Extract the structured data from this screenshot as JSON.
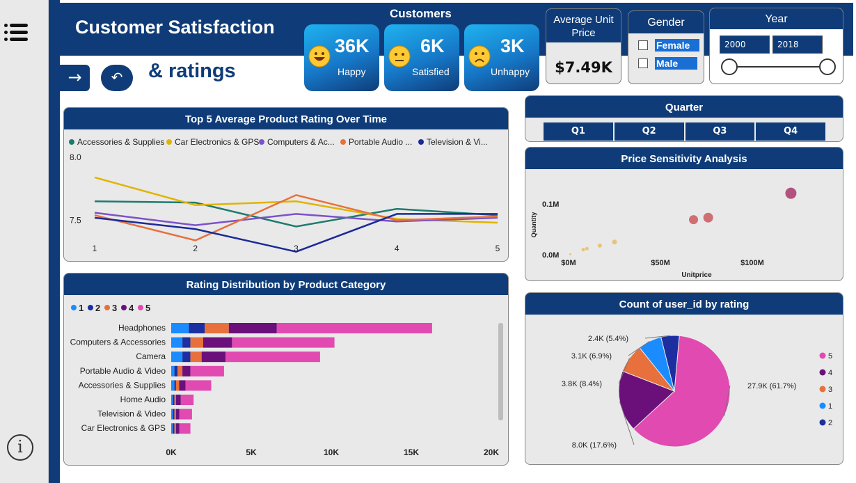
{
  "header": {
    "title_line1": "Customer Satisfaction",
    "title_line2": "& ratings"
  },
  "nav": {
    "forward_icon": "→",
    "back_icon": "↶"
  },
  "info_icon": "i",
  "customers": {
    "title": "Customers",
    "cards": [
      {
        "value": "36K",
        "label": "Happy",
        "emoji": "grinning-face-icon"
      },
      {
        "value": "6K",
        "label": "Satisfied",
        "emoji": "neutral-face-icon"
      },
      {
        "value": "3K",
        "label": "Unhappy",
        "emoji": "frowning-face-icon"
      }
    ]
  },
  "avg_unit_price": {
    "title": "Average Unit Price",
    "value": "$7.49K"
  },
  "gender": {
    "title": "Gender",
    "options": [
      "Female",
      "Male"
    ]
  },
  "year": {
    "title": "Year",
    "from": "2000",
    "to": "2018"
  },
  "quarter": {
    "title": "Quarter",
    "options": [
      "Q1",
      "Q2",
      "Q3",
      "Q4"
    ]
  },
  "colors": {
    "navy": "#0f3c78",
    "teal": "#1f7a6e",
    "gold": "#e0b400",
    "purple": "#7b52c9",
    "orange": "#e8703c",
    "darkblue": "#1b2a96",
    "r1": "#1a8cff",
    "r2": "#1c2ea0",
    "r3": "#e8703c",
    "r4": "#6b0f7a",
    "r5": "#e14ab0"
  },
  "chart_data": [
    {
      "id": "line",
      "type": "line",
      "title": "Top 5 Average Product Rating Over Time",
      "x": [
        "1",
        "2",
        "3",
        "4",
        "5"
      ],
      "ytick_labels": [
        "8.0",
        "7.5"
      ],
      "ylim": [
        7.32,
        8.0
      ],
      "series": [
        {
          "name": "Accessories & Supplies",
          "color": "#1f7a6e",
          "values": [
            7.65,
            7.64,
            7.45,
            7.59,
            7.54
          ]
        },
        {
          "name": "Car Electronics & GPS",
          "color": "#e0b400",
          "values": [
            7.84,
            7.62,
            7.65,
            7.51,
            7.48
          ]
        },
        {
          "name": "Computers & Ac...",
          "color": "#7b52c9",
          "values": [
            7.56,
            7.46,
            7.55,
            7.49,
            7.52
          ]
        },
        {
          "name": "Portable Audio ...",
          "color": "#e8703c",
          "values": [
            7.54,
            7.34,
            7.7,
            7.5,
            7.53
          ]
        },
        {
          "name": "Television & Vi...",
          "color": "#1b2a96",
          "values": [
            7.52,
            7.43,
            7.25,
            7.55,
            7.55
          ]
        }
      ]
    },
    {
      "id": "bar",
      "type": "bar",
      "title": "Rating Distribution by Product Category",
      "legend": [
        "1",
        "2",
        "3",
        "4",
        "5"
      ],
      "colors": [
        "#1a8cff",
        "#1c2ea0",
        "#e8703c",
        "#6b0f7a",
        "#e14ab0"
      ],
      "categories": [
        "Headphones",
        "Computers & Accessories",
        "Camera",
        "Portable Audio & Video",
        "Accessories & Supplies",
        "Home Audio",
        "Television & Video",
        "Car Electronics & GPS"
      ],
      "stacks": [
        [
          1100,
          1000,
          1500,
          3000,
          9700
        ],
        [
          700,
          500,
          800,
          1800,
          6400
        ],
        [
          700,
          500,
          700,
          1500,
          5900
        ],
        [
          200,
          200,
          300,
          500,
          2100
        ],
        [
          200,
          100,
          200,
          400,
          1600
        ],
        [
          100,
          100,
          100,
          300,
          800
        ],
        [
          100,
          100,
          100,
          200,
          800
        ],
        [
          100,
          100,
          100,
          200,
          700
        ]
      ],
      "xticks": [
        "0K",
        "5K",
        "10K",
        "15K",
        "20K"
      ],
      "xlim": [
        0,
        20000
      ]
    },
    {
      "id": "scatter",
      "type": "scatter",
      "title": "Price Sensitivity Analysis",
      "xlabel": "Unitprice",
      "ylabel": "Quantity",
      "xticks": [
        "$0M",
        "$50M",
        "$100M"
      ],
      "yticks": [
        "0.0M",
        "0.1M"
      ],
      "xlim": [
        0,
        100
      ],
      "ylim": [
        0,
        0.1
      ],
      "points": [
        {
          "x": 1,
          "y": 0.001,
          "size": 1.5,
          "color": "#e8c47a"
        },
        {
          "x": 8,
          "y": 0.01,
          "size": 2.5,
          "color": "#e8c47a"
        },
        {
          "x": 10,
          "y": 0.012,
          "size": 2.5,
          "color": "#e8c47a"
        },
        {
          "x": 17,
          "y": 0.018,
          "size": 3,
          "color": "#e8c47a"
        },
        {
          "x": 25,
          "y": 0.025,
          "size": 3.5,
          "color": "#e8c47a"
        },
        {
          "x": 68,
          "y": 0.069,
          "size": 6.5,
          "color": "#cf6e73"
        },
        {
          "x": 76,
          "y": 0.073,
          "size": 7,
          "color": "#cf6e73"
        },
        {
          "x": 121,
          "y": 0.121,
          "size": 8,
          "color": "#b3527e"
        }
      ]
    },
    {
      "id": "pie",
      "type": "pie",
      "title": "Count of user_id by rating",
      "slices": [
        {
          "label": "5",
          "value": 27.9,
          "text": "27.9K (61.7%)",
          "color": "#e14ab0"
        },
        {
          "label": "4",
          "value": 8.0,
          "text": "8.0K (17.6%)",
          "color": "#6b0f7a"
        },
        {
          "label": "3",
          "value": 3.8,
          "text": "3.8K (8.4%)",
          "color": "#e8703c"
        },
        {
          "label": "1",
          "value": 3.1,
          "text": "3.1K (6.9%)",
          "color": "#1a8cff"
        },
        {
          "label": "2",
          "value": 2.4,
          "text": "2.4K (5.4%)",
          "color": "#1c2ea0"
        }
      ]
    }
  ]
}
